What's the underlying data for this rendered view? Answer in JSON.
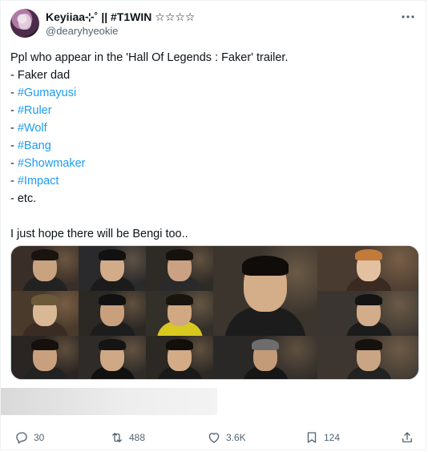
{
  "user": {
    "display_name": "Keyiiaa⊹˚ || #T1WIN ☆☆☆☆",
    "handle": "@dearyhyeokie"
  },
  "tweet": {
    "lines": [
      {
        "text": "Ppl who appear in the 'Hall Of Legends : Faker' trailer.",
        "tag": false
      },
      {
        "text": "- Faker dad",
        "tag": false
      },
      {
        "prefix": "- ",
        "text": "#Gumayusi",
        "tag": true
      },
      {
        "prefix": "- ",
        "text": "#Ruler",
        "tag": true
      },
      {
        "prefix": "- ",
        "text": "#Wolf",
        "tag": true
      },
      {
        "prefix": "- ",
        "text": "#Bang",
        "tag": true
      },
      {
        "prefix": "- ",
        "text": "#Showmaker",
        "tag": true
      },
      {
        "prefix": "- ",
        "text": "#Impact",
        "tag": true
      },
      {
        "text": "- etc.",
        "tag": false
      }
    ],
    "closing": "I just hope there will be Bengi too.."
  },
  "actions": {
    "replies": "30",
    "retweets": "488",
    "likes": "3.6K",
    "bookmarks": "124"
  },
  "icons": {
    "reply": "reply-icon",
    "retweet": "retweet-icon",
    "like": "heart-icon",
    "bookmark": "bookmark-icon",
    "share": "share-icon",
    "more": "more-icon"
  },
  "colors": {
    "link": "#1d9bf0",
    "muted": "#536471",
    "text": "#0f1419"
  }
}
